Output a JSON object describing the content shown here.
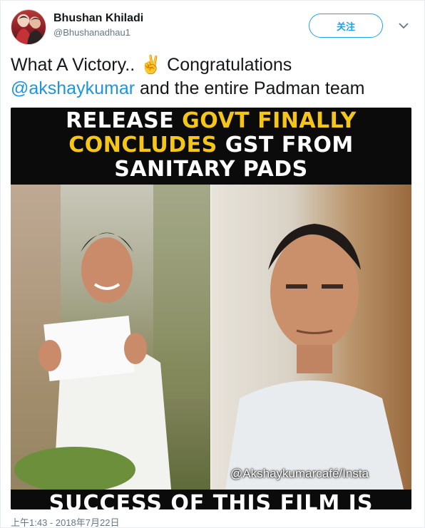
{
  "user": {
    "display_name": "Bhushan Khiladi",
    "handle": "@Bhushanadhau1"
  },
  "follow_button": {
    "label": "关注"
  },
  "tweet": {
    "text_line1": "What A Victory.. ✌️ Congratulations",
    "mention": "@akshaykumar",
    "text_line2_rest": " and the entire Padman team"
  },
  "media": {
    "headline_line1_white": "RELEASE ",
    "headline_line1_yellow": "GOVT FINALLY",
    "headline_line2_yellow": "CONCLUDES",
    "headline_line2_white": " GST FROM",
    "headline_line3_white": "SANITARY PADS",
    "bottom_text": "SUCCESS OF THIS FILM IS",
    "credit": "@Akshaykumarcafé/Insta"
  },
  "timestamp": "上午1:43 - 2018年7月22日",
  "icons": {
    "caret": "chevron-down-icon",
    "avatar": "avatar"
  },
  "colors": {
    "accent": "#1da1f2",
    "mention": "#1b95e0",
    "headline_yellow": "#f5c518",
    "meta_text": "#657786"
  }
}
